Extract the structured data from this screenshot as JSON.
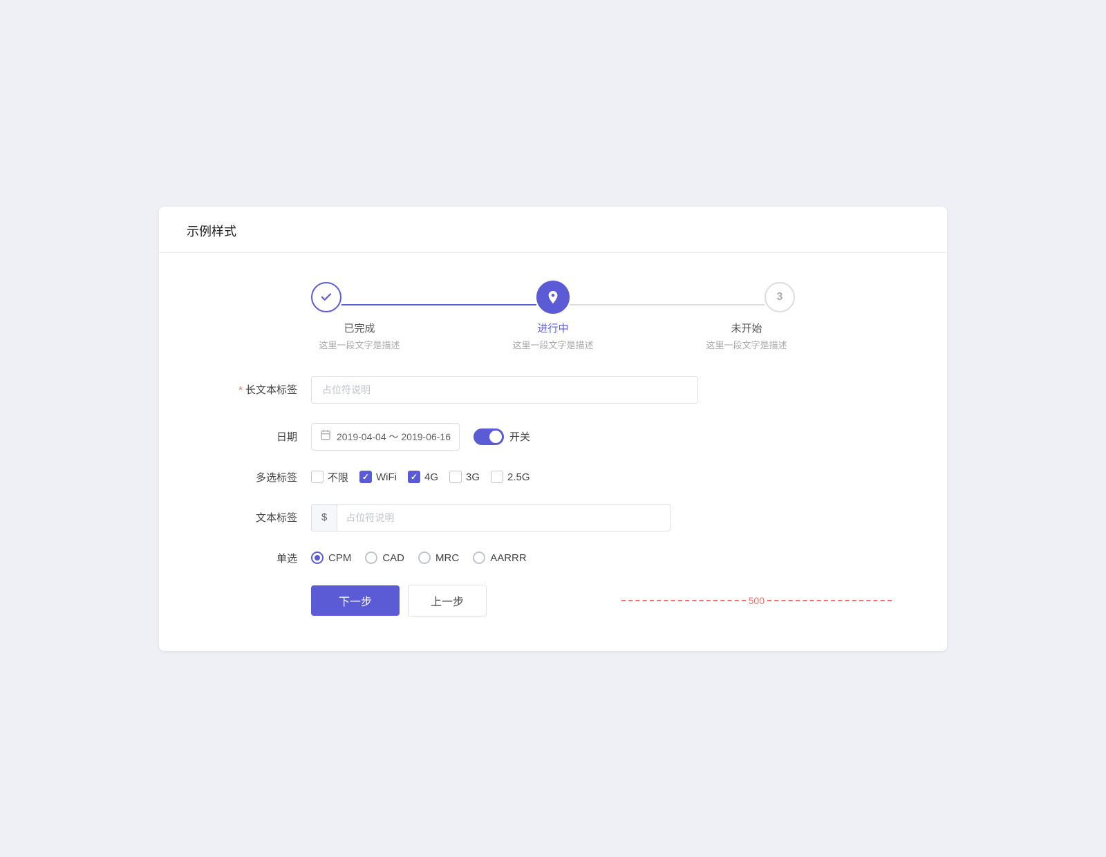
{
  "page": {
    "title": "示例样式"
  },
  "steps": [
    {
      "id": "step1",
      "state": "done",
      "number": "✓",
      "title": "已完成",
      "desc": "这里一段文字是描述"
    },
    {
      "id": "step2",
      "state": "active",
      "number": "📍",
      "title": "进行中",
      "desc": "这里一段文字是描述"
    },
    {
      "id": "step3",
      "state": "pending",
      "number": "3",
      "title": "未开始",
      "desc": "这里一段文字是描述"
    }
  ],
  "form": {
    "long_text_label": "长文本标签",
    "long_text_placeholder": "占位符说明",
    "required_star": "*",
    "date_label": "日期",
    "date_value": "2019-04-04 ～ 2019-06-16",
    "toggle_label": "开关",
    "multi_label": "多选标签",
    "checkboxes": [
      {
        "id": "cb_no_limit",
        "label": "不限",
        "checked": false
      },
      {
        "id": "cb_wifi",
        "label": "WiFi",
        "checked": true
      },
      {
        "id": "cb_4g",
        "label": "4G",
        "checked": true
      },
      {
        "id": "cb_3g",
        "label": "3G",
        "checked": false
      },
      {
        "id": "cb_25g",
        "label": "2.5G",
        "checked": false
      }
    ],
    "text_label": "文本标签",
    "text_prefix": "$",
    "text_placeholder": "占位符说明",
    "radio_label": "单选",
    "radios": [
      {
        "id": "r_cpm",
        "label": "CPM",
        "selected": true
      },
      {
        "id": "r_cad",
        "label": "CAD",
        "selected": false
      },
      {
        "id": "r_mrc",
        "label": "MRC",
        "selected": false
      },
      {
        "id": "r_aarrr",
        "label": "AARRR",
        "selected": false
      }
    ]
  },
  "buttons": {
    "next": "下一步",
    "prev": "上一步"
  },
  "dashed": {
    "value": "500"
  }
}
